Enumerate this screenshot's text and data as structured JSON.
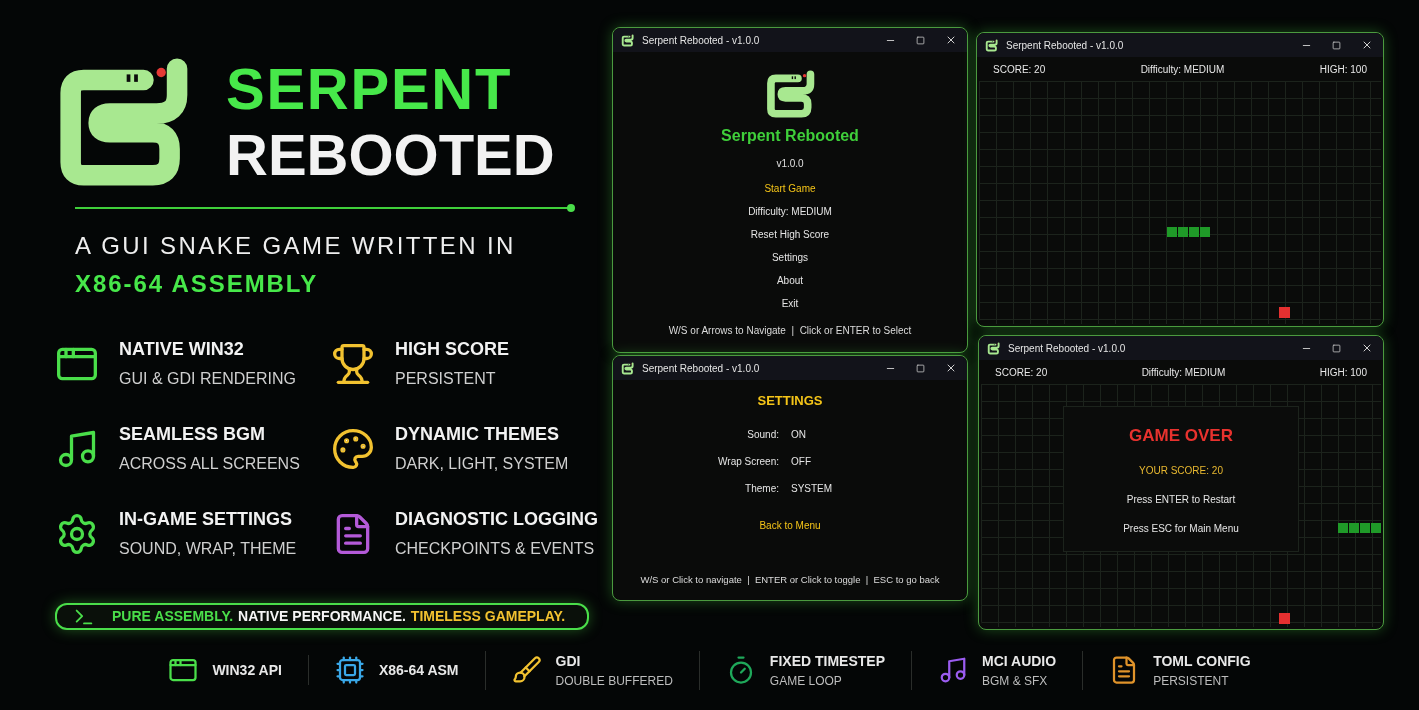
{
  "hero": {
    "title_line_1": "SERPENT",
    "title_line_2": "REBOOTED",
    "subtitle": "A GUI SNAKE GAME WRITTEN IN",
    "subtitle_highlight": "X86-64 ASSEMBLY"
  },
  "features": [
    {
      "kind": "window",
      "title": "NATIVE WIN32",
      "subtitle": "GUI & GDI RENDERING",
      "color": "#4ade4a"
    },
    {
      "kind": "trophy",
      "title": "HIGH SCORE",
      "subtitle": "PERSISTENT",
      "color": "#f2c230"
    },
    {
      "kind": "music",
      "title": "SEAMLESS BGM",
      "subtitle": "ACROSS ALL SCREENS",
      "color": "#4ade4a"
    },
    {
      "kind": "palette",
      "title": "DYNAMIC THEMES",
      "subtitle": "DARK, LIGHT, SYSTEM",
      "color": "#f2c230"
    },
    {
      "kind": "gear",
      "title": "IN-GAME SETTINGS",
      "subtitle": "SOUND, WRAP, THEME",
      "color": "#4ade4a"
    },
    {
      "kind": "document",
      "title": "DIAGNOSTIC LOGGING",
      "subtitle": "CHECKPOINTS & EVENTS",
      "color": "#b45ad8"
    }
  ],
  "tagline": [
    {
      "text": "PURE ASSEMBLY.",
      "kind": "green"
    },
    {
      "text": "NATIVE PERFORMANCE.",
      "kind": "plain"
    },
    {
      "text": "TIMELESS GAMEPLAY.",
      "kind": "gold"
    }
  ],
  "windows": [
    {
      "kind": "menu",
      "title": "Serpent Rebooted - v1.0.0",
      "app_name": "Serpent Rebooted",
      "version": "v1.0.0",
      "items": [
        {
          "label": "Start Game",
          "selected": true
        },
        {
          "label": "Difficulty: MEDIUM",
          "selected": false
        },
        {
          "label": "Reset High Score",
          "selected": false
        },
        {
          "label": "Settings",
          "selected": false
        },
        {
          "label": "About",
          "selected": false
        },
        {
          "label": "Exit",
          "selected": false
        }
      ],
      "hint": "W/S or Arrows to Navigate  |  Click or ENTER to Select"
    },
    {
      "kind": "settings",
      "title": "Serpent Rebooted - v1.0.0",
      "heading": "SETTINGS",
      "items": [
        {
          "label": "Sound:",
          "value": "ON",
          "selected": false
        },
        {
          "label": "Wrap Screen:",
          "value": "OFF",
          "selected": false
        },
        {
          "label": "Theme:",
          "value": "SYSTEM",
          "selected": false
        }
      ],
      "back": {
        "label": "Back to Menu",
        "selected": true
      },
      "hint": "W/S or Click to navigate  |  ENTER or Click to toggle  |  ESC to go back"
    },
    {
      "kind": "game",
      "title": "Serpent Rebooted - v1.0.0",
      "score": "SCORE: 20",
      "difficulty": "Difficulty: MEDIUM",
      "high": "HIGH: 100"
    },
    {
      "kind": "game_over",
      "title": "Serpent Rebooted - v1.0.0",
      "score": "SCORE: 20",
      "difficulty": "Difficulty: MEDIUM",
      "high": "HIGH: 100",
      "heading": "GAME OVER",
      "your_score": "YOUR SCORE: 20",
      "restart": "Press ENTER to Restart",
      "menu": "Press ESC for Main Menu"
    }
  ],
  "tech_bar": [
    {
      "kind": "window",
      "title": "WIN32 API",
      "color": "#4ade4a"
    },
    {
      "kind": "chip",
      "title": "X86-64 ASM",
      "color": "#3aa8e8"
    },
    {
      "kind": "brush",
      "title": "GDI",
      "subtitle": "DOUBLE BUFFERED",
      "color": "#f2c230"
    },
    {
      "kind": "clock",
      "title": "FIXED TIMESTEP",
      "subtitle": "GAME LOOP",
      "color": "#1fa85a"
    },
    {
      "kind": "music",
      "title": "MCI AUDIO",
      "subtitle": "BGM & SFX",
      "color": "#9b5cf0"
    },
    {
      "kind": "document",
      "title": "TOML CONFIG",
      "subtitle": "PERSISTENT",
      "color": "#e0932a"
    }
  ]
}
